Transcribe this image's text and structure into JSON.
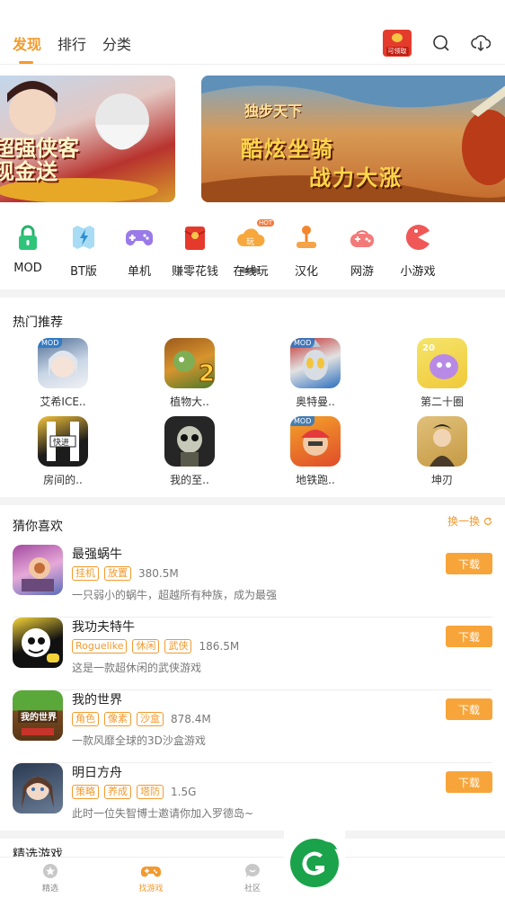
{
  "header": {
    "tabs": [
      "发现",
      "排行",
      "分类"
    ],
    "redpack_label": "可领取",
    "icons": [
      "red-envelope-icon",
      "search-icon",
      "download-icon"
    ]
  },
  "banners": [
    {
      "lines": [
        "超强侠客",
        "现金送"
      ]
    },
    {
      "small": "独步天下",
      "line1": "酷炫坐骑",
      "line2": "战力大涨"
    }
  ],
  "categories": [
    "MOD",
    "BT版",
    "单机",
    "赚零花钱",
    "在线玩",
    "汉化",
    "网游",
    "小游戏"
  ],
  "hot_badge": "HOT",
  "play_badge": "玩",
  "hot": {
    "title": "热门推荐",
    "mod_tag": "MOD",
    "items": [
      "艾希ICE..",
      "植物大..",
      "奥特曼..",
      "第二十圈",
      "房间的..",
      "我的至..",
      "地铁跑..",
      "坤刃"
    ]
  },
  "guess": {
    "title": "猜你喜欢",
    "refresh": "换一换",
    "download_label": "下载",
    "games": [
      {
        "name": "最强蜗牛",
        "tags": [
          "挂机",
          "放置"
        ],
        "size": "380.5M",
        "desc": "一只弱小的蜗牛，超越所有种族，成为最强"
      },
      {
        "name": "我功夫特牛",
        "tags": [
          "Roguelike",
          "休闲",
          "武侠"
        ],
        "size": "186.5M",
        "desc": "这是一款超休闲的武侠游戏"
      },
      {
        "name": "我的世界",
        "tags": [
          "角色",
          "像素",
          "沙盒"
        ],
        "size": "878.4M",
        "desc": "一款风靡全球的3D沙盒游戏"
      },
      {
        "name": "明日方舟",
        "tags": [
          "策略",
          "养成",
          "塔防"
        ],
        "size": "1.5G",
        "desc": "此时一位失智博士邀请你加入罗德岛~"
      }
    ]
  },
  "next_section_title": "精选游戏",
  "bottom_nav": [
    "精选",
    "找游戏",
    "社区"
  ],
  "colors": {
    "accent": "#f29a2e",
    "download": "#f7a53a",
    "logo_green": "#1aa34a"
  }
}
